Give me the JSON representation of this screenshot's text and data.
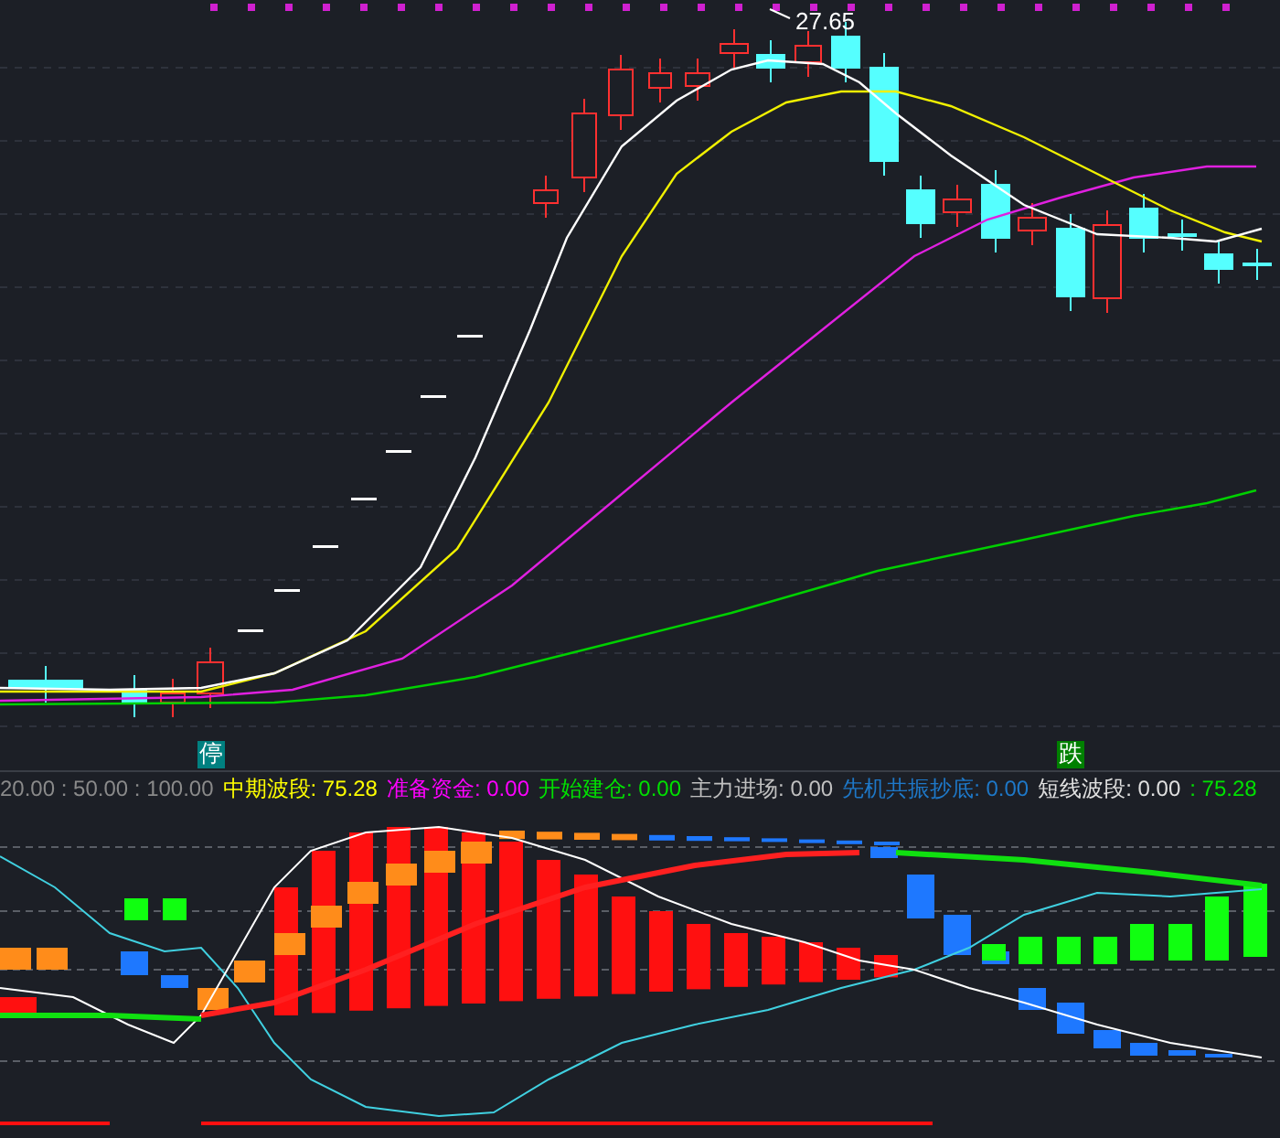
{
  "price_chart": {
    "high_label": "27.65"
  },
  "signal_markers": [
    {
      "text": "停",
      "color": "#008080"
    },
    {
      "text": "跌",
      "color": "#008000"
    }
  ],
  "indicator_legend": {
    "params": "20.00 : 50.00 : 100.00",
    "items": [
      {
        "text": "中期波段: 75.28",
        "color": "#ffff00"
      },
      {
        "text": "准备资金: 0.00",
        "color": "#ff00ff"
      },
      {
        "text": "开始建仓: 0.00",
        "color": "#00e000"
      },
      {
        "text": "主力进场: 0.00",
        "color": "#c0c0c0"
      },
      {
        "text": "先机共振抄底: 0.00",
        "color": "#1e78c8"
      },
      {
        "text": "短线波段: 0.00",
        "color": "#e0e0e0"
      },
      {
        "text": ": 75.28",
        "color": "#00e000"
      }
    ]
  }
}
